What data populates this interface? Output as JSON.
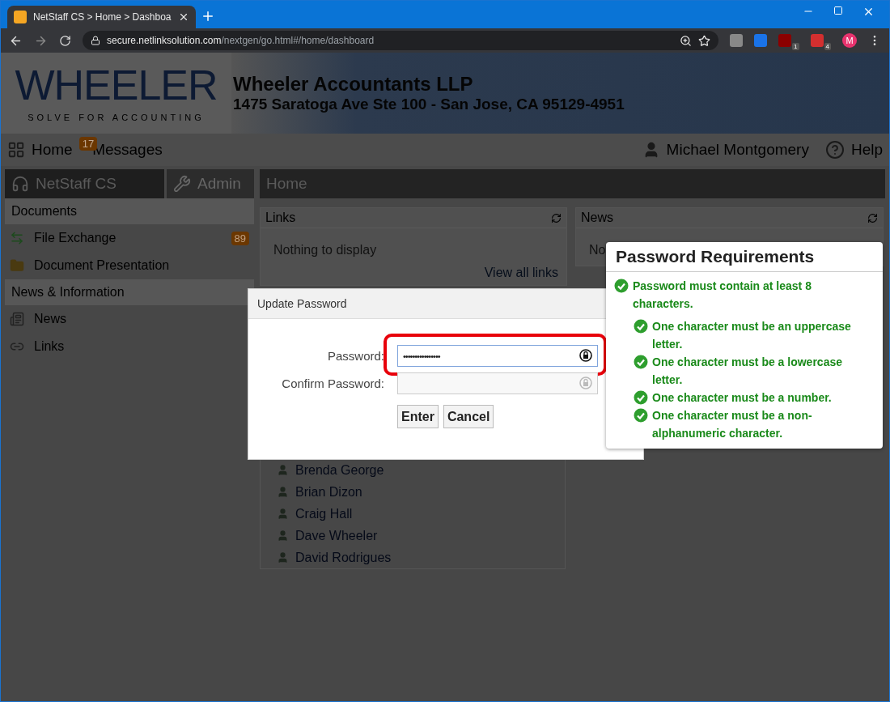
{
  "browser": {
    "tab_title": "NetStaff CS > Home > Dashboa",
    "url_host": "secure.netlinksolution.com",
    "url_path": "/nextgen/go.html#/home/dashboard",
    "extension_badges": [
      "1",
      "4"
    ],
    "profile_initial": "M"
  },
  "header": {
    "logo_text": "WHEELER",
    "logo_tagline": "SOLVE FOR ACCOUNTING",
    "company": "Wheeler Accountants LLP",
    "address": "1475 Saratoga Ave Ste 100 - San Jose, CA 95129-4951"
  },
  "navbar": {
    "home": "Home",
    "messages_count": "17",
    "messages": "Messages",
    "user": "Michael Montgomery",
    "help": "Help"
  },
  "sidebar": {
    "tabs": [
      {
        "label": "NetStaff CS",
        "kind": "headset",
        "selected": true
      },
      {
        "label": "Admin",
        "kind": "tools",
        "selected": false
      }
    ],
    "sections": [
      {
        "title": "Documents",
        "items": [
          {
            "label": "File Exchange",
            "kind": "exchange",
            "badge": "89"
          },
          {
            "label": "Document Presentation",
            "kind": "folder"
          }
        ]
      },
      {
        "title": "News & Information",
        "items": [
          {
            "label": "News",
            "kind": "news"
          },
          {
            "label": "Links",
            "kind": "link"
          }
        ]
      }
    ]
  },
  "main": {
    "title": "Home",
    "links_panel": {
      "title": "Links",
      "empty": "Nothing to display",
      "link": "View all links"
    },
    "news_panel": {
      "title": "News",
      "empty": "No"
    },
    "people": [
      "Brenda George",
      "Brian Dizon",
      "Craig Hall",
      "Dave Wheeler",
      "David Rodrigues"
    ]
  },
  "dialog": {
    "title": "Update Password",
    "fields": [
      {
        "label": "Password:",
        "value": "••••••••••••••••",
        "focused": true
      },
      {
        "label": "Confirm Password:",
        "focused": false
      }
    ],
    "buttons": [
      "Enter",
      "Cancel"
    ]
  },
  "requirements": {
    "title": "Password Requirements",
    "items": [
      {
        "text": "Password must contain at least 8 characters.",
        "met": true,
        "children": [
          {
            "text": "One character must be an uppercase letter.",
            "met": true
          },
          {
            "text": "One character must be a lowercase letter.",
            "met": true
          },
          {
            "text": "One character must be a number.",
            "met": true
          },
          {
            "text": "One character must be a non-alphanumeric character.",
            "met": true
          }
        ]
      }
    ]
  }
}
